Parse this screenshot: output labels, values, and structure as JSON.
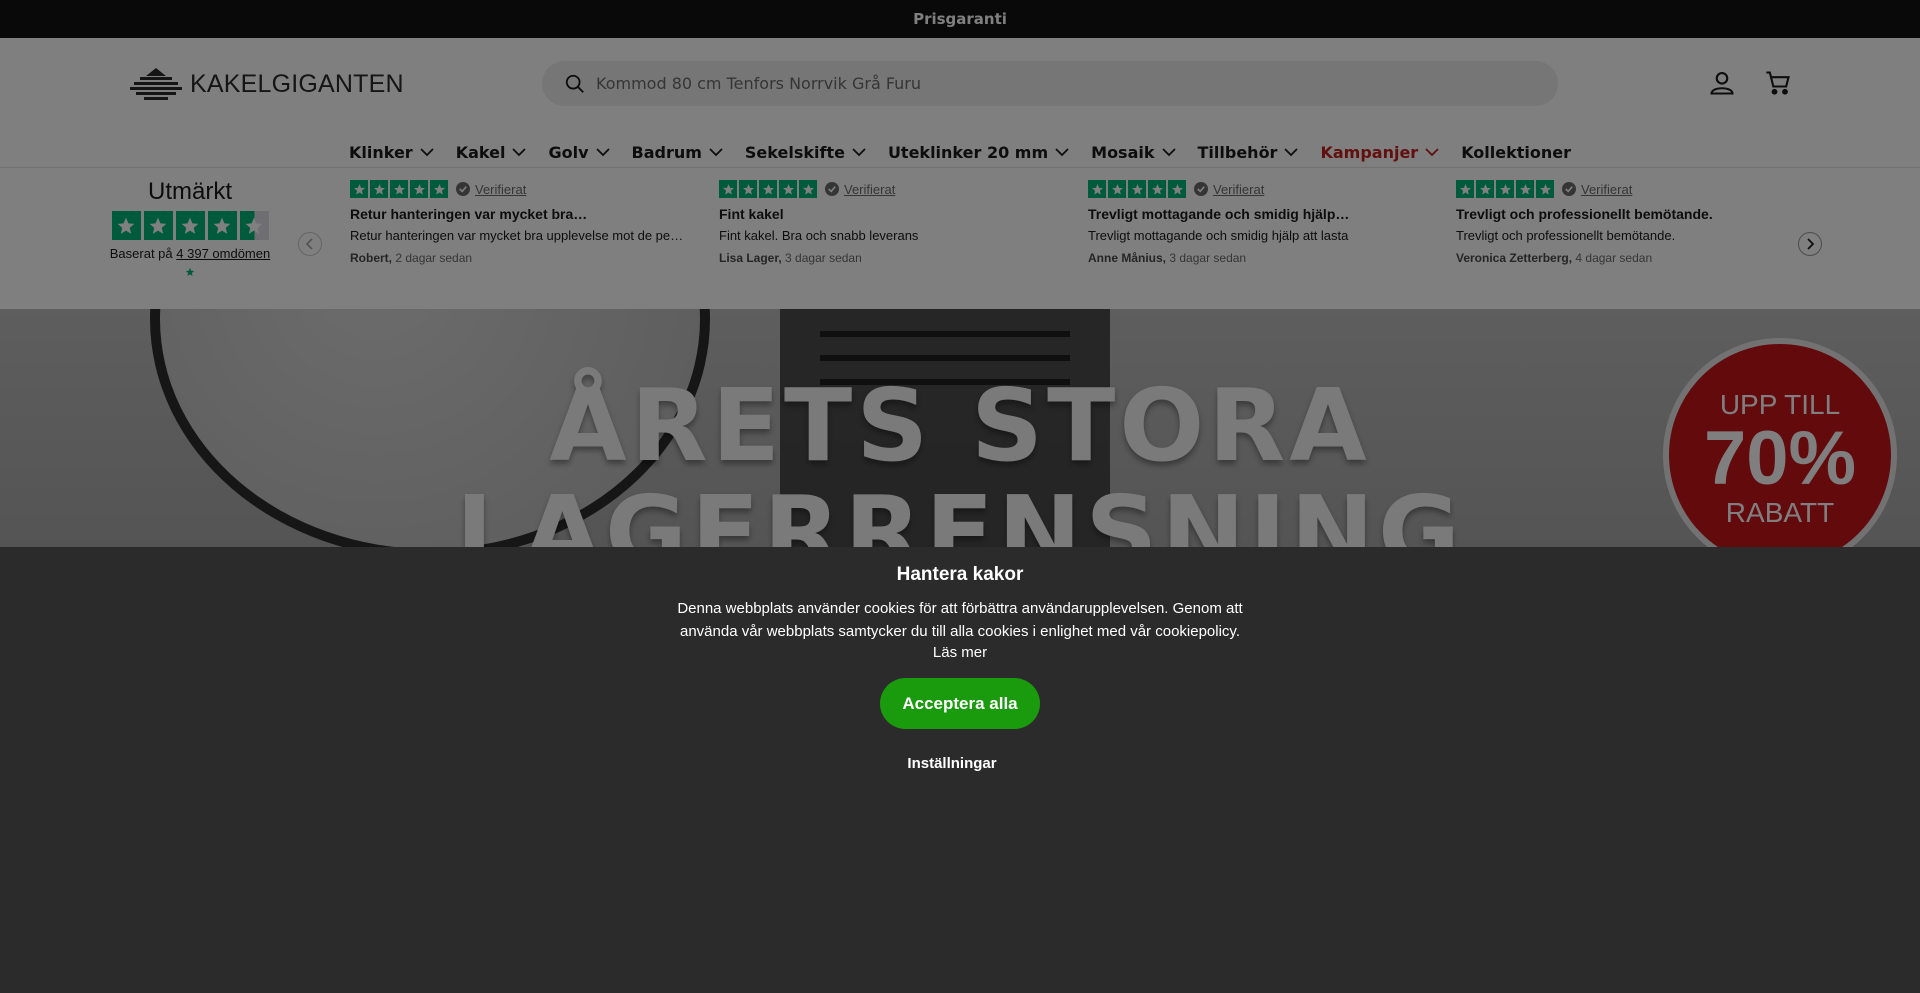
{
  "announcement": {
    "text": "Prisgaranti"
  },
  "header": {
    "logo_text": "KAKELGIGANTEN",
    "search_placeholder": "Kommod 80 cm Tenfors Norrvik Grå Furu",
    "icons": [
      "search-icon",
      "account-icon",
      "cart-icon"
    ]
  },
  "nav": {
    "items": [
      {
        "label": "Klinker",
        "dropdown": true
      },
      {
        "label": "Kakel",
        "dropdown": true
      },
      {
        "label": "Golv",
        "dropdown": true
      },
      {
        "label": "Badrum",
        "dropdown": true
      },
      {
        "label": "Sekelskifte",
        "dropdown": true
      },
      {
        "label": "Uteklinker 20 mm",
        "dropdown": true
      },
      {
        "label": "Mosaik",
        "dropdown": true
      },
      {
        "label": "Tillbehör",
        "dropdown": true
      },
      {
        "label": "Kampanjer",
        "dropdown": true,
        "color": "#c41e1e"
      },
      {
        "label": "Kollektioner",
        "dropdown": false
      }
    ]
  },
  "trustpilot": {
    "rating_word": "Utmärkt",
    "rating_stars": 4.5,
    "based_on_prefix": "Baserat på",
    "based_on_link": "4 397 omdömen",
    "verified_label": "Verifierat",
    "reviews": [
      {
        "stars": 5,
        "title": "Retur hanteringen var mycket bra…",
        "text": "Retur hanteringen var mycket bra upplevelse mot de pe…",
        "author": "Robert,",
        "when": "2 dagar sedan"
      },
      {
        "stars": 5,
        "title": "Fint kakel",
        "text": "Fint kakel. Bra och snabb leverans",
        "author": "Lisa Lager,",
        "when": "3 dagar sedan"
      },
      {
        "stars": 5,
        "title": "Trevligt mottagande och smidig hjälp…",
        "text": "Trevligt mottagande och smidig hjälp att lasta",
        "author": "Anne Månius,",
        "when": "3 dagar sedan"
      },
      {
        "stars": 5,
        "title": "Trevligt och professionellt bemötande.",
        "text": "Trevligt och professionellt bemötande.",
        "author": "Veronica Zetterberg,",
        "when": "4 dagar sedan"
      }
    ]
  },
  "hero": {
    "line1": "ÅRETS STORA",
    "line2": "LAGERRENSNING",
    "badge_top": "UPP TILL",
    "badge_mid": "70%",
    "badge_bot": "RABATT"
  },
  "cookie": {
    "title": "Hantera kakor",
    "text": "Denna webbplats använder cookies för att förbättra användarupplevelsen. Genom att använda vår webbplats samtycker du till alla cookies i enlighet med vår cookiepolicy.",
    "read_more": "Läs mer",
    "accept_label": "Acceptera alla",
    "settings_label": "Inställningar",
    "accept_color": "#1a9b0d"
  }
}
